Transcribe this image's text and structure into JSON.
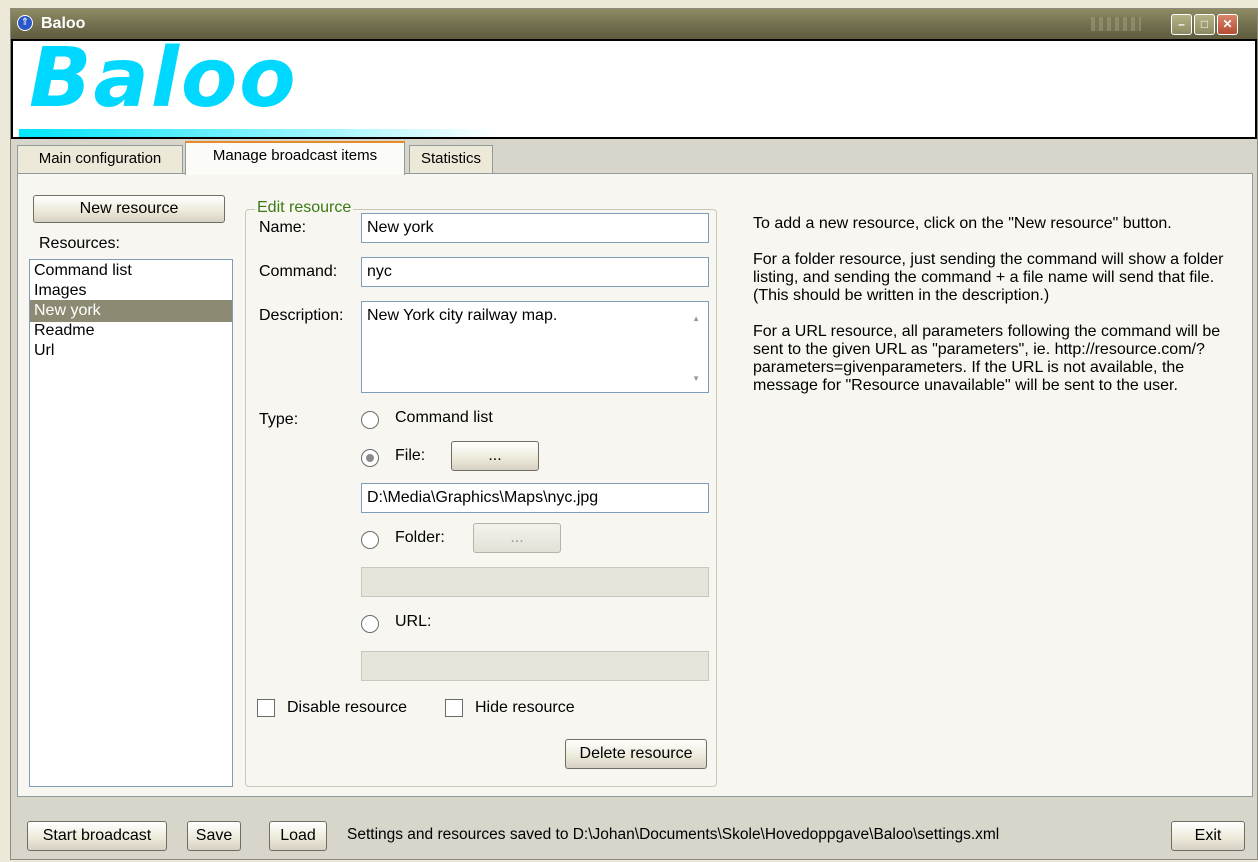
{
  "window": {
    "title": "Baloo"
  },
  "banner": {
    "logo": "Baloo"
  },
  "tabs": [
    {
      "label": "Main configuration"
    },
    {
      "label": "Manage broadcast items"
    },
    {
      "label": "Statistics"
    }
  ],
  "sidebar": {
    "new_resource_label": "New resource",
    "resources_label": "Resources:",
    "items": [
      {
        "label": "Command list"
      },
      {
        "label": "Images"
      },
      {
        "label": "New york"
      },
      {
        "label": "Readme"
      },
      {
        "label": "Url"
      }
    ],
    "selected": "New york"
  },
  "edit": {
    "legend": "Edit resource",
    "name_label": "Name:",
    "name_value": "New york",
    "command_label": "Command:",
    "command_value": "nyc",
    "description_label": "Description:",
    "description_value": "New York city railway map.",
    "type_label": "Type:",
    "type_command_list": "Command list",
    "type_file": "File:",
    "type_folder": "Folder:",
    "type_url": "URL:",
    "browse_label": "...",
    "file_path": "D:\\Media\\Graphics\\Maps\\nyc.jpg",
    "folder_path": "",
    "url_value": "",
    "selected_type": "File",
    "disable_label": "Disable resource",
    "hide_label": "Hide resource",
    "delete_label": "Delete resource"
  },
  "help": {
    "p1": "To add a new resource, click on the \"New resource\" button.",
    "p2": "For a folder resource, just sending the command will show a folder listing, and sending the command + a file name will send that file. (This should be written in the description.)",
    "p3": "For a URL resource, all parameters following the command will be sent to the given URL as \"parameters\", ie. http://resource.com/?parameters=givenparameters. If the URL is not available, the message for \"Resource unavailable\" will be sent to the user."
  },
  "footer": {
    "start_label": "Start broadcast",
    "save_label": "Save",
    "load_label": "Load",
    "status": "Settings and resources saved to D:\\Johan\\Documents\\Skole\\Hovedoppgave\\Baloo\\settings.xml",
    "exit_label": "Exit"
  },
  "colors": {
    "logo": "#00d8ff",
    "selection": "#8c8a72",
    "legend": "#3a7a14"
  }
}
